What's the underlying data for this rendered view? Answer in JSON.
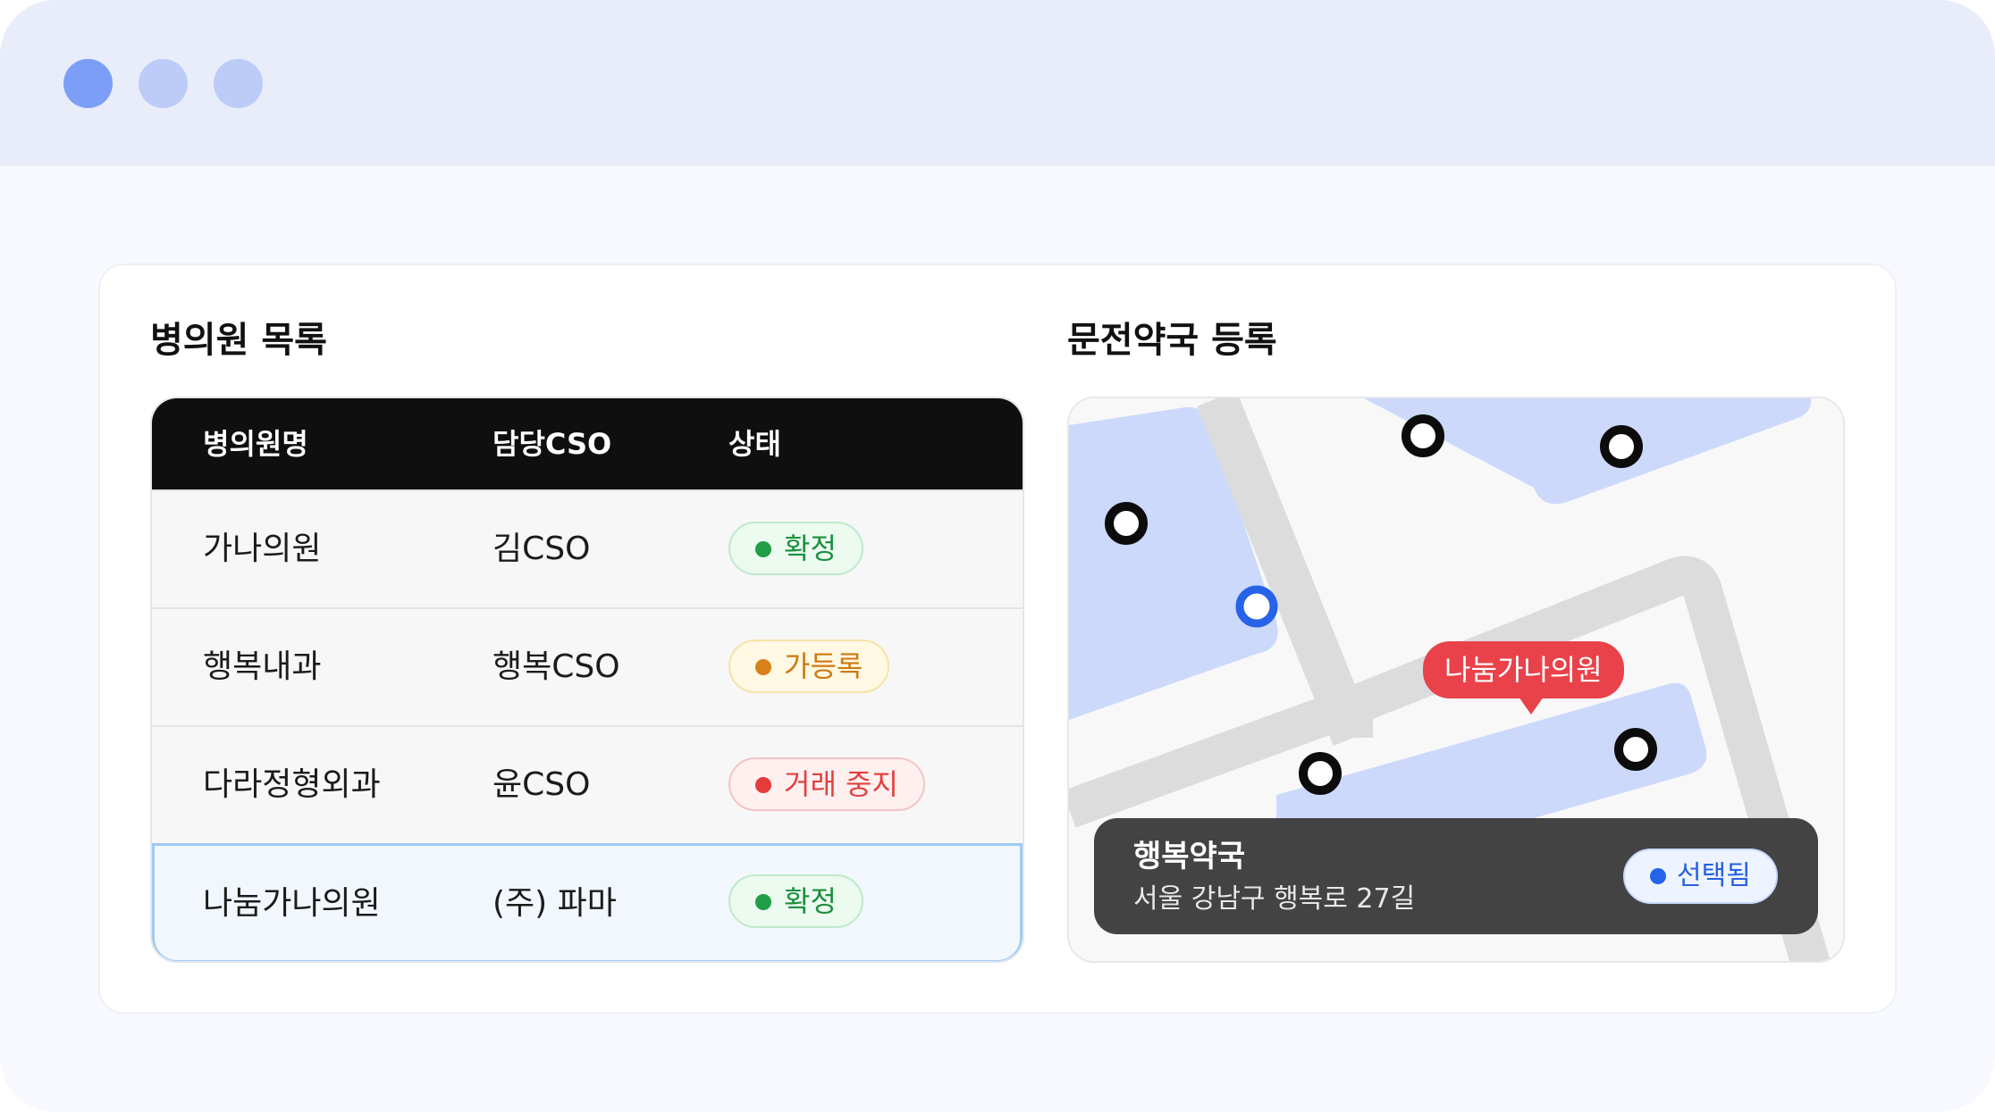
{
  "window": {
    "controls": [
      {
        "name": "window-control-1",
        "color": "#7d9ef7"
      },
      {
        "name": "window-control-2",
        "color": "#bccbf8"
      },
      {
        "name": "window-control-3",
        "color": "#bccbf8"
      }
    ]
  },
  "clinic_list": {
    "title": "병의원 목록",
    "columns": [
      "병의원명",
      "담당CSO",
      "상태"
    ],
    "rows": [
      {
        "name": "가나의원",
        "cso": "김CSO",
        "status": "확정",
        "status_color": "green"
      },
      {
        "name": "행복내과",
        "cso": "행복CSO",
        "status": "가등록",
        "status_color": "yellow"
      },
      {
        "name": "다라정형외과",
        "cso": "윤CSO",
        "status": "거래 중지",
        "status_color": "red"
      },
      {
        "name": "나눔가나의원",
        "cso": "(주) 파마",
        "status": "확정",
        "status_color": "green",
        "selected": true
      }
    ]
  },
  "pharmacy_register": {
    "title": "문전약국 등록",
    "map": {
      "selected_clinic_label": "나눔가나의원",
      "block_color": "#ccd9fb",
      "road_color": "#dcdcdc",
      "pin_label_color": "#e9424a"
    },
    "selected_pharmacy": {
      "name": "행복약국",
      "address": "서울 강남구 행복로 27길",
      "badge": "선택됨"
    }
  }
}
